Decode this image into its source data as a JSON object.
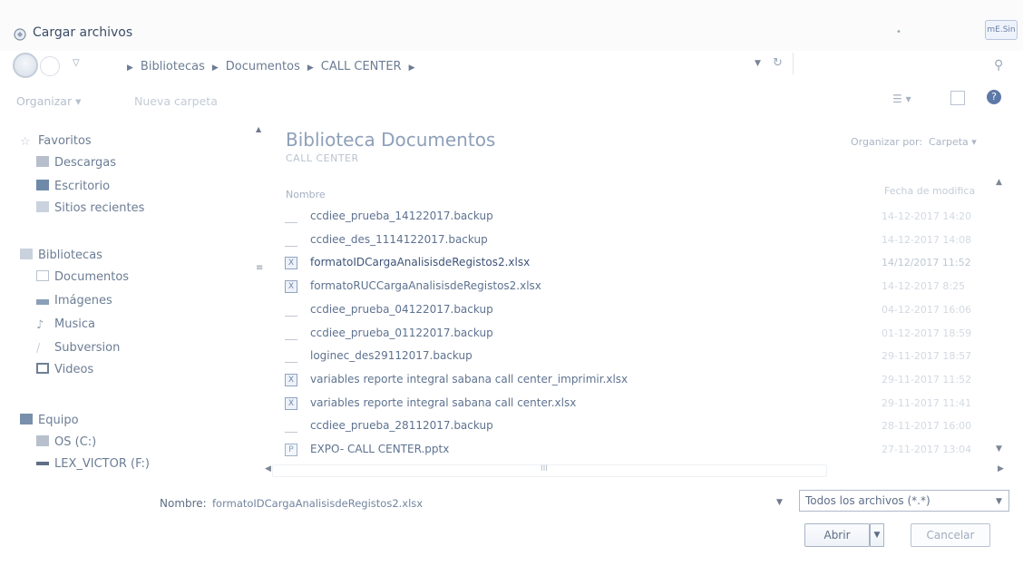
{
  "window": {
    "title": "Cargar archivos",
    "title_icon": "folder-open-icon",
    "corner_label": "mE.Sin"
  },
  "address": {
    "breadcrumb": [
      "Bibliotecas",
      "Documentos",
      "CALL CENTER"
    ],
    "icons": {
      "back": "back-arrow-icon",
      "forward": "forward-arrow-icon",
      "refresh": "refresh-icon",
      "search": "search-icon"
    }
  },
  "toolbar": {
    "organize": "Organizar ▾",
    "new_folder": "Nueva carpeta",
    "help": "?"
  },
  "nav": {
    "favorites": {
      "label": "Favoritos",
      "items": [
        "Descargas",
        "Escritorio",
        "Sitios recientes"
      ]
    },
    "libraries": {
      "label": "Bibliotecas",
      "items": [
        "Documentos",
        "Imágenes",
        "Musica",
        "Subversion",
        "Videos"
      ]
    },
    "computer": {
      "label": "Equipo",
      "items": [
        "OS (C:)",
        "LEX_VICTOR (F:)"
      ]
    }
  },
  "content": {
    "library_title": "Biblioteca Documentos",
    "library_subtitle": "CALL CENTER",
    "arrange_label": "Organizar por:",
    "arrange_value": "Carpeta ▾",
    "columns": {
      "name": "Nombre",
      "date": "Fecha de modifica"
    },
    "files": [
      {
        "name": "ccdiee_prueba_14122017.backup",
        "date": "14-12-2017 14:20",
        "type": "backup"
      },
      {
        "name": "ccdiee_des_1114122017.backup",
        "date": "14-12-2017 14:08",
        "type": "backup"
      },
      {
        "name": "formatoIDCargaAnalisisdeRegistos2.xlsx",
        "date": "14/12/2017 11:52",
        "type": "xlsx",
        "selected": true
      },
      {
        "name": "formatoRUCCargaAnalisisdeRegistos2.xlsx",
        "date": "14-12-2017 8:25",
        "type": "xlsx"
      },
      {
        "name": "ccdiee_prueba_04122017.backup",
        "date": "04-12-2017 16:06",
        "type": "backup"
      },
      {
        "name": "ccdiee_prueba_01122017.backup",
        "date": "01-12-2017 18:59",
        "type": "backup"
      },
      {
        "name": "loginec_des29112017.backup",
        "date": "29-11-2017 18:57",
        "type": "backup"
      },
      {
        "name": "variables reporte integral sabana call center_imprimir.xlsx",
        "date": "29-11-2017 11:52",
        "type": "xlsx"
      },
      {
        "name": "variables reporte integral sabana call center.xlsx",
        "date": "29-11-2017 11:41",
        "type": "xlsx"
      },
      {
        "name": "ccdiee_prueba_28112017.backup",
        "date": "28-11-2017 16:00",
        "type": "backup"
      },
      {
        "name": "EXPO- CALL CENTER.pptx",
        "date": "27-11-2017 13:04",
        "type": "pptx"
      }
    ]
  },
  "footer": {
    "name_label": "Nombre:",
    "name_value": "formatoIDCargaAnalisisdeRegistos2.xlsx",
    "file_type": "Todos los archivos (*.*)",
    "open": "Abrir",
    "cancel": "Cancelar"
  }
}
